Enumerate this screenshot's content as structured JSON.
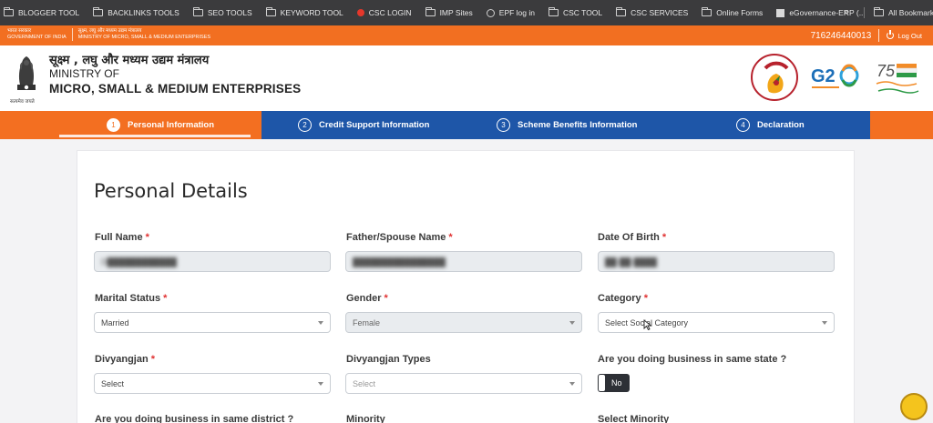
{
  "bookmarks": [
    {
      "label": "BLOGGER TOOL",
      "icon": "folder-icon"
    },
    {
      "label": "BACKLINKS TOOLS",
      "icon": "folder-icon"
    },
    {
      "label": "SEO TOOLS",
      "icon": "folder-icon"
    },
    {
      "label": "KEYWORD TOOL",
      "icon": "folder-icon"
    },
    {
      "label": "CSC LOGIN",
      "icon": "csc-icon"
    },
    {
      "label": "IMP Sites",
      "icon": "folder-icon"
    },
    {
      "label": "EPF log in",
      "icon": "globe-icon"
    },
    {
      "label": "CSC TOOL",
      "icon": "folder-icon"
    },
    {
      "label": "CSC SERVICES",
      "icon": "folder-icon"
    },
    {
      "label": "Online Forms",
      "icon": "folder-icon"
    },
    {
      "label": "eGovernance-ERP (...",
      "icon": "egov-icon"
    }
  ],
  "bookmarks_more": "»",
  "all_bookmarks": "All Bookmarks",
  "gov_strip": {
    "hindi_gov": "भारत सरकार",
    "english_gov": "GOVERNMENT OF INDIA",
    "hindi_ministry": "सूक्ष्म, लघु और मध्यम उद्यम मंत्रालय",
    "english_ministry": "MINISTRY OF MICRO, SMALL & MEDIUM ENTERPRISES",
    "phone": "716246440013",
    "logout": "Log Out"
  },
  "header": {
    "hindi_title": "सूक्ष्म , लघु और मध्यम उद्यम मंत्रालय",
    "ministry_of": "MINISTRY OF",
    "msme": "MICRO, SMALL & MEDIUM ENTERPRISES",
    "emblem_caption": "सत्यमेव जयते"
  },
  "steps": [
    {
      "num": "1",
      "label": "Personal Information"
    },
    {
      "num": "2",
      "label": "Credit Support Information"
    },
    {
      "num": "3",
      "label": "Scheme Benefits Information"
    },
    {
      "num": "4",
      "label": "Declaration"
    }
  ],
  "form": {
    "title": "Personal Details",
    "full_name": {
      "label": "Full Name",
      "value": "D████████████"
    },
    "father_name": {
      "label": "Father/Spouse Name",
      "value": "████████████████"
    },
    "dob": {
      "label": "Date Of Birth",
      "value": "██-██-████"
    },
    "marital": {
      "label": "Marital Status",
      "value": "Married"
    },
    "gender": {
      "label": "Gender",
      "value": "Female"
    },
    "category": {
      "label": "Category",
      "placeholder": "Select Social Category"
    },
    "divyangjan": {
      "label": "Divyangjan",
      "value": "Select"
    },
    "divyangjan_types": {
      "label": "Divyangjan Types",
      "value": "Select"
    },
    "same_state": {
      "label": "Are you doing business in same state ?",
      "toggle": "No"
    },
    "same_district": {
      "label": "Are you doing business in same district ?"
    },
    "minority": {
      "label": "Minority"
    },
    "select_minority": {
      "label": "Select Minority"
    }
  },
  "required_mark": "*",
  "colors": {
    "orange": "#F36F21",
    "blue": "#1E56A8"
  }
}
